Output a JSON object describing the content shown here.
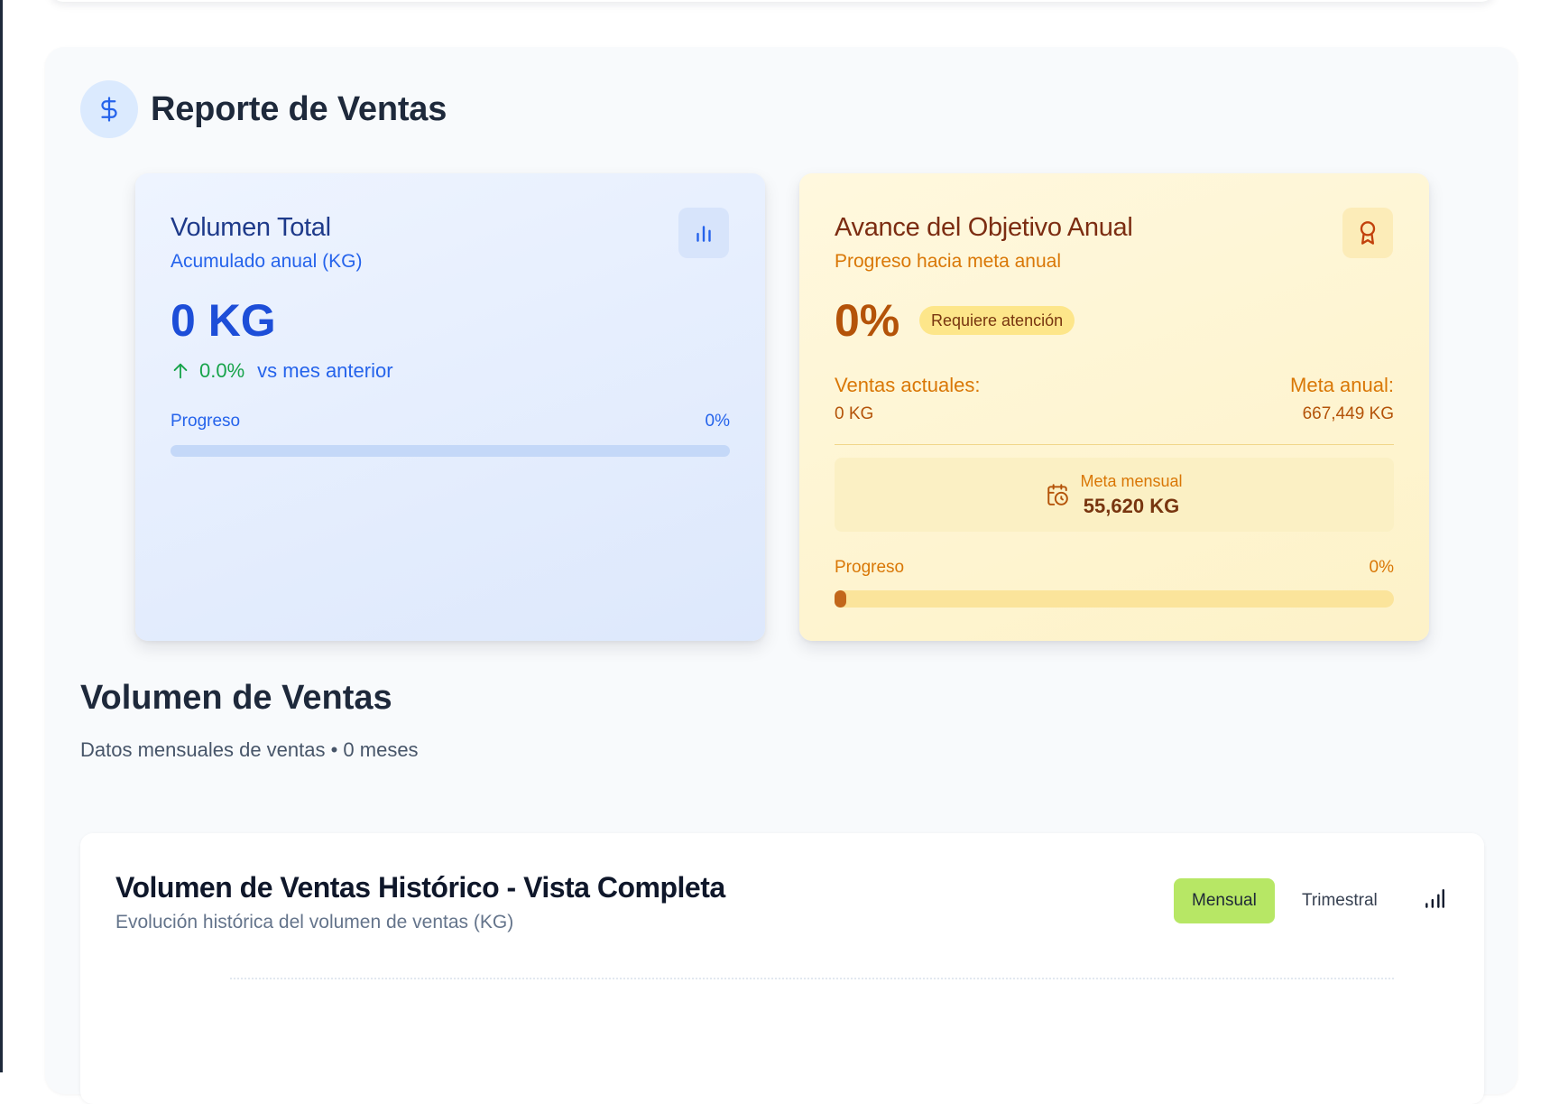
{
  "report": {
    "title": "Reporte de Ventas",
    "icon": "dollar-icon"
  },
  "volume_card": {
    "title": "Volumen Total",
    "subtitle": "Acumulado anual (KG)",
    "value": "0 KG",
    "trend_pct": "0.0%",
    "trend_text": "vs mes anterior",
    "progress_label": "Progreso",
    "progress_pct": "0%",
    "progress_value": 0,
    "icon": "bar-chart-icon"
  },
  "goal_card": {
    "title": "Avance del Objetivo Anual",
    "subtitle": "Progreso hacia meta anual",
    "pct": "0%",
    "badge": "Requiere atención",
    "current_label": "Ventas actuales:",
    "current_value": "0 KG",
    "goal_label": "Meta anual:",
    "goal_value": "667,449 KG",
    "monthly_label": "Meta mensual",
    "monthly_value": "55,620 KG",
    "progress_label": "Progreso",
    "progress_pct": "0%",
    "progress_value": 0,
    "icon": "award-icon"
  },
  "section": {
    "title": "Volumen de Ventas",
    "subtitle": "Datos mensuales de ventas • 0 meses"
  },
  "chart": {
    "title": "Volumen de Ventas Histórico - Vista Completa",
    "subtitle": "Evolución histórica del volumen de ventas (KG)",
    "toggle_monthly": "Mensual",
    "toggle_quarterly": "Trimestral",
    "active_toggle": "Mensual",
    "icon": "bar-chart-icon"
  },
  "colors": {
    "accent_blue": "#2563eb",
    "accent_amber": "#d97706",
    "toggle_active": "#b7e765",
    "positive": "#16a34a"
  }
}
